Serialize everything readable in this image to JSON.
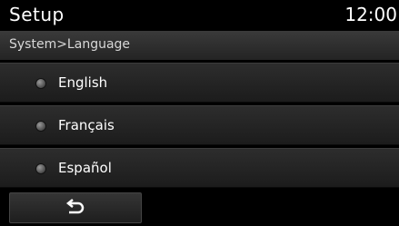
{
  "header": {
    "title": "Setup",
    "clock": "12:00"
  },
  "breadcrumb": "System>Language",
  "languages": [
    {
      "label": "English"
    },
    {
      "label": "Français"
    },
    {
      "label": "Español"
    }
  ],
  "back_button": {
    "icon": "back-arrow-icon"
  },
  "colors": {
    "background": "#000000",
    "text": "#ffffff"
  }
}
